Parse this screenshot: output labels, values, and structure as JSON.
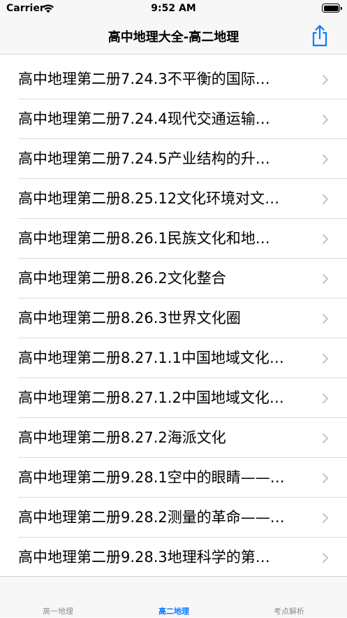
{
  "status_bar": {
    "carrier": "Carrier",
    "time": "9:52 AM"
  },
  "nav": {
    "title": "高中地理大全-高二地理"
  },
  "list": {
    "items": [
      {
        "label": "高中地理第二册7.24.3不平衡的国际…"
      },
      {
        "label": "高中地理第二册7.24.4现代交通运输…"
      },
      {
        "label": "高中地理第二册7.24.5产业结构的升…"
      },
      {
        "label": "高中地理第二册8.25.12文化环境对文…"
      },
      {
        "label": "高中地理第二册8.26.1民族文化和地…"
      },
      {
        "label": "高中地理第二册8.26.2文化整合"
      },
      {
        "label": "高中地理第二册8.26.3世界文化圈"
      },
      {
        "label": "高中地理第二册8.27.1.1中国地域文化…"
      },
      {
        "label": "高中地理第二册8.27.1.2中国地域文化…"
      },
      {
        "label": "高中地理第二册8.27.2海派文化"
      },
      {
        "label": "高中地理第二册9.28.1空中的眼睛——…"
      },
      {
        "label": "高中地理第二册9.28.2测量的革命——…"
      },
      {
        "label": "高中地理第二册9.28.3地理科学的第…"
      }
    ]
  },
  "tabs": [
    {
      "label": "高一地理"
    },
    {
      "label": "高二地理"
    },
    {
      "label": "考点解析"
    }
  ],
  "colors": {
    "accent": "#0a7aff",
    "chevron": "#c4c4c7"
  }
}
